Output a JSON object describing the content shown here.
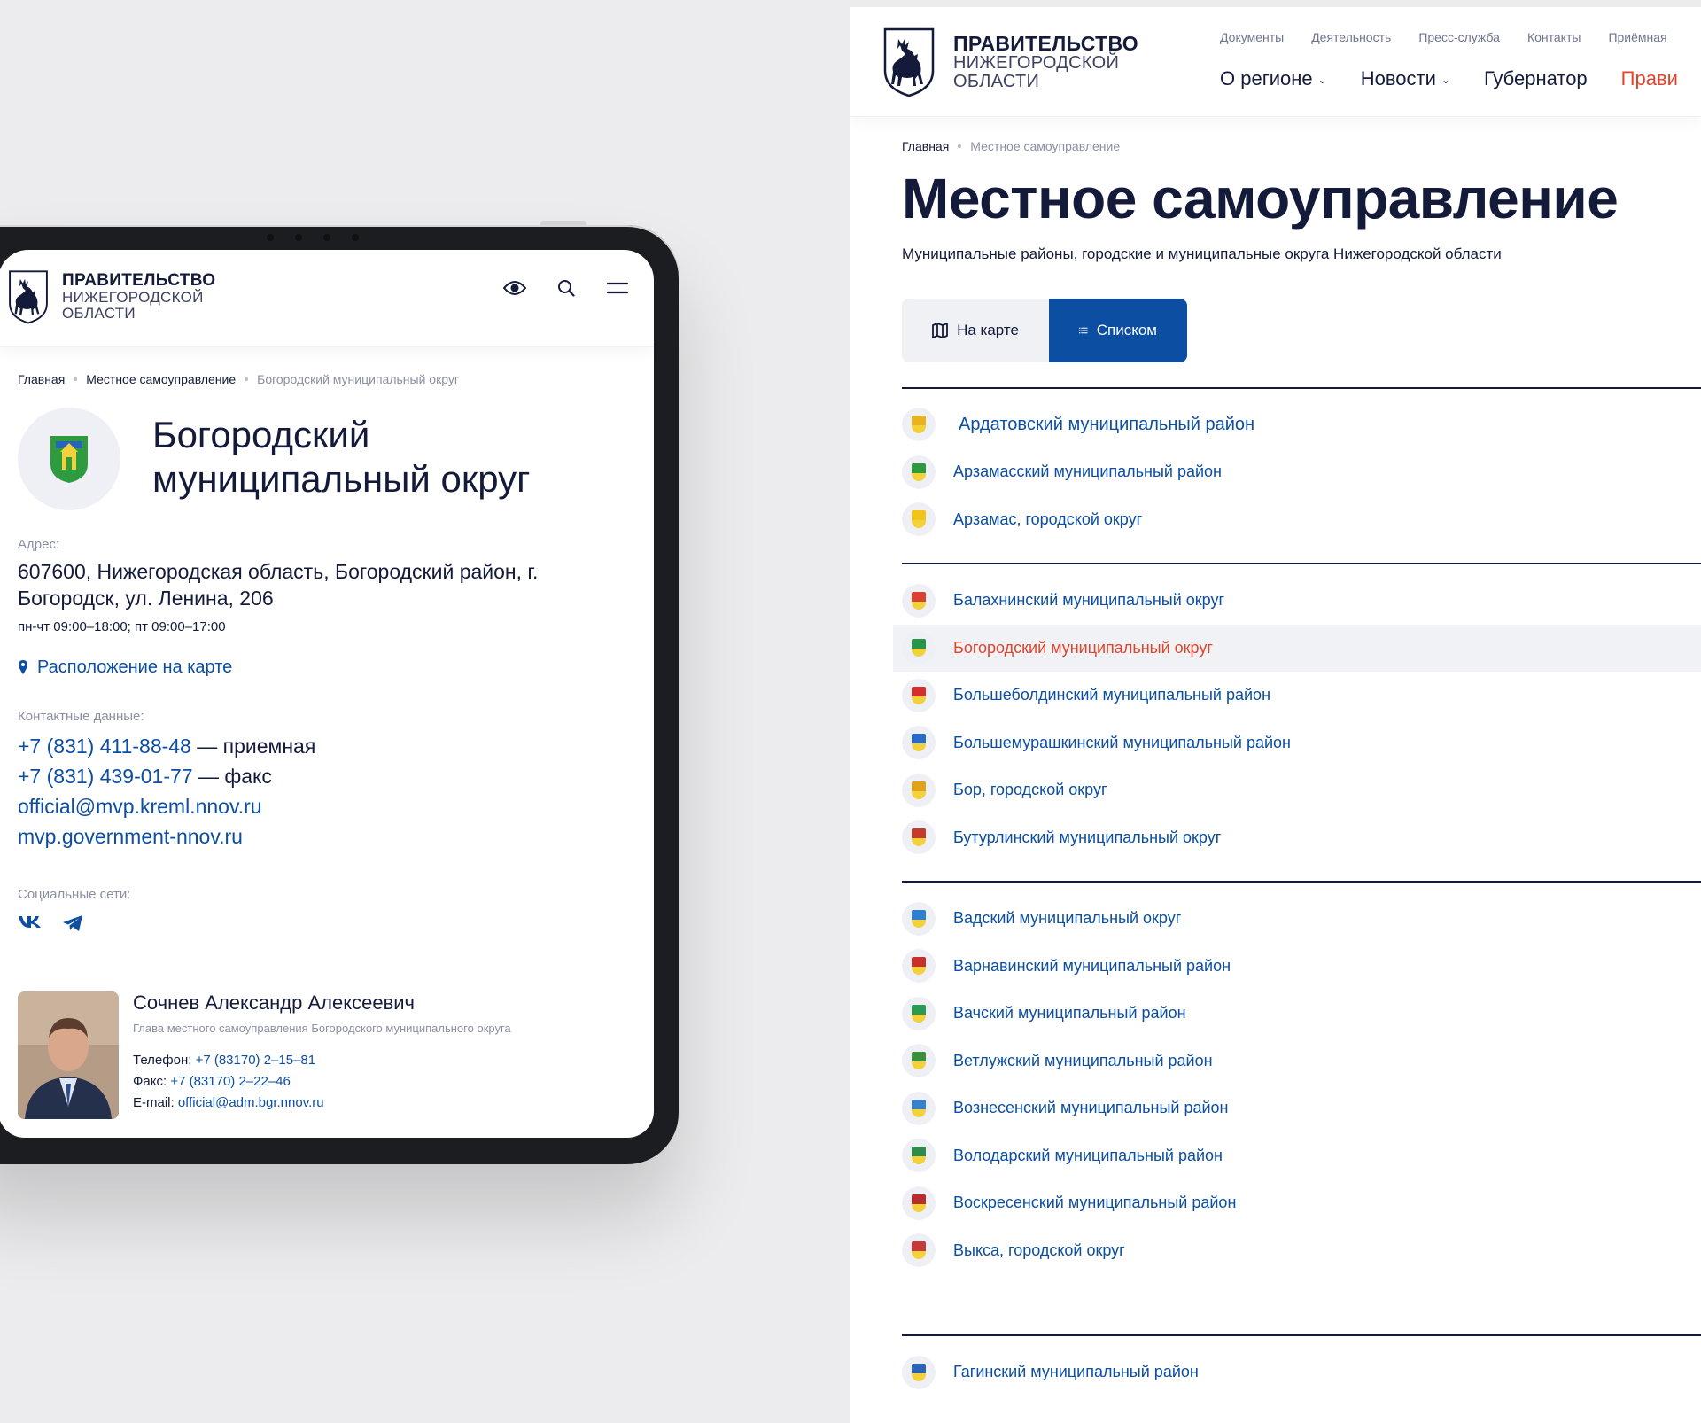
{
  "brand": {
    "line1": "ПРАВИТЕЛЬСТВО",
    "line2": "НИЖЕГОРОДСКОЙ",
    "line3": "ОБЛАСТИ"
  },
  "tablet": {
    "breadcrumbs": [
      "Главная",
      "Местное самоуправление",
      "Богородский муниципальный округ"
    ],
    "title_line1": "Богородский",
    "title_line2": "муниципальный округ",
    "address_label": "Адрес:",
    "address_line1": "607600, Нижегородская область, Богородский район, г.",
    "address_line2": "Богородск, ул. Ленина, 206",
    "hours": "пн-чт 09:00–18:00; пт 09:00–17:00",
    "map_link": "Расположение на карте",
    "contacts_label": "Контактные данные:",
    "phone1": "+7 (831) 411-88-48",
    "phone1_suffix": " — приемная",
    "phone2": "+7 (831) 439-01-77",
    "phone2_suffix": " — факс",
    "email": "official@mvp.kreml.nnov.ru",
    "website": "mvp.government-nnov.ru",
    "social_label": "Социальные сети:",
    "person": {
      "name": "Сочнев Александр Алексеевич",
      "role": "Глава местного самоуправления Богородского муниципального округа",
      "phone_label": "Телефон:",
      "phone": "+7 (83170) 2–15–81",
      "fax_label": "Факс:",
      "fax": "+7 (83170) 2–22–46",
      "email_label": "E-mail:",
      "email": "official@adm.bgr.nnov.ru"
    }
  },
  "desktop": {
    "top_nav": [
      "Документы",
      "Деятельность",
      "Пресс-служба",
      "Контакты",
      "Приёмная"
    ],
    "main_nav": [
      {
        "label": "О регионе",
        "dropdown": true
      },
      {
        "label": "Новости",
        "dropdown": true
      },
      {
        "label": "Губернатор",
        "dropdown": false
      },
      {
        "label": "Прави",
        "dropdown": false
      }
    ],
    "breadcrumbs": [
      "Главная",
      "Местное самоуправление"
    ],
    "title": "Местное самоуправление",
    "subtitle": "Муниципальные районы, городские и муниципальные округа Нижегородской области",
    "view_map": "На карте",
    "view_list": "Списком",
    "groups": [
      {
        "items": [
          {
            "name": "Ардатовский муниципальный район",
            "color": "#e8b320"
          },
          {
            "name": "Арзамасский муниципальный район",
            "color": "#2e9a3e"
          },
          {
            "name": "Арзамас, городской округ",
            "color": "#f0c419"
          }
        ]
      },
      {
        "items": [
          {
            "name": "Балахнинский муниципальный округ",
            "color": "#d9402f"
          },
          {
            "name": "Богородский муниципальный округ",
            "color": "#27954a",
            "active": true
          },
          {
            "name": "Большеболдинский муниципальный район",
            "color": "#d22f2f"
          },
          {
            "name": "Большемурашкинский муниципальный район",
            "color": "#2a6bc4"
          },
          {
            "name": "Бор, городской округ",
            "color": "#e0a11c"
          },
          {
            "name": "Бутурлинский муниципальный округ",
            "color": "#c23b2b"
          }
        ]
      },
      {
        "items": [
          {
            "name": "Вадский муниципальный округ",
            "color": "#2f7fd0"
          },
          {
            "name": "Варнавинский муниципальный район",
            "color": "#c9302c"
          },
          {
            "name": "Вачский муниципальный район",
            "color": "#2b9a55"
          },
          {
            "name": "Ветлужский муниципальный район",
            "color": "#3c8f3c"
          },
          {
            "name": "Вознесенский муниципальный район",
            "color": "#3a7fc9"
          },
          {
            "name": "Володарский муниципальный район",
            "color": "#2f8a4c"
          },
          {
            "name": "Воскресенский муниципальный район",
            "color": "#b82e2e"
          },
          {
            "name": "Выкса, городской округ",
            "color": "#c73a3a"
          }
        ]
      },
      {
        "items": [
          {
            "name": "Гагинский муниципальный район",
            "color": "#2b63b8"
          }
        ]
      }
    ]
  }
}
